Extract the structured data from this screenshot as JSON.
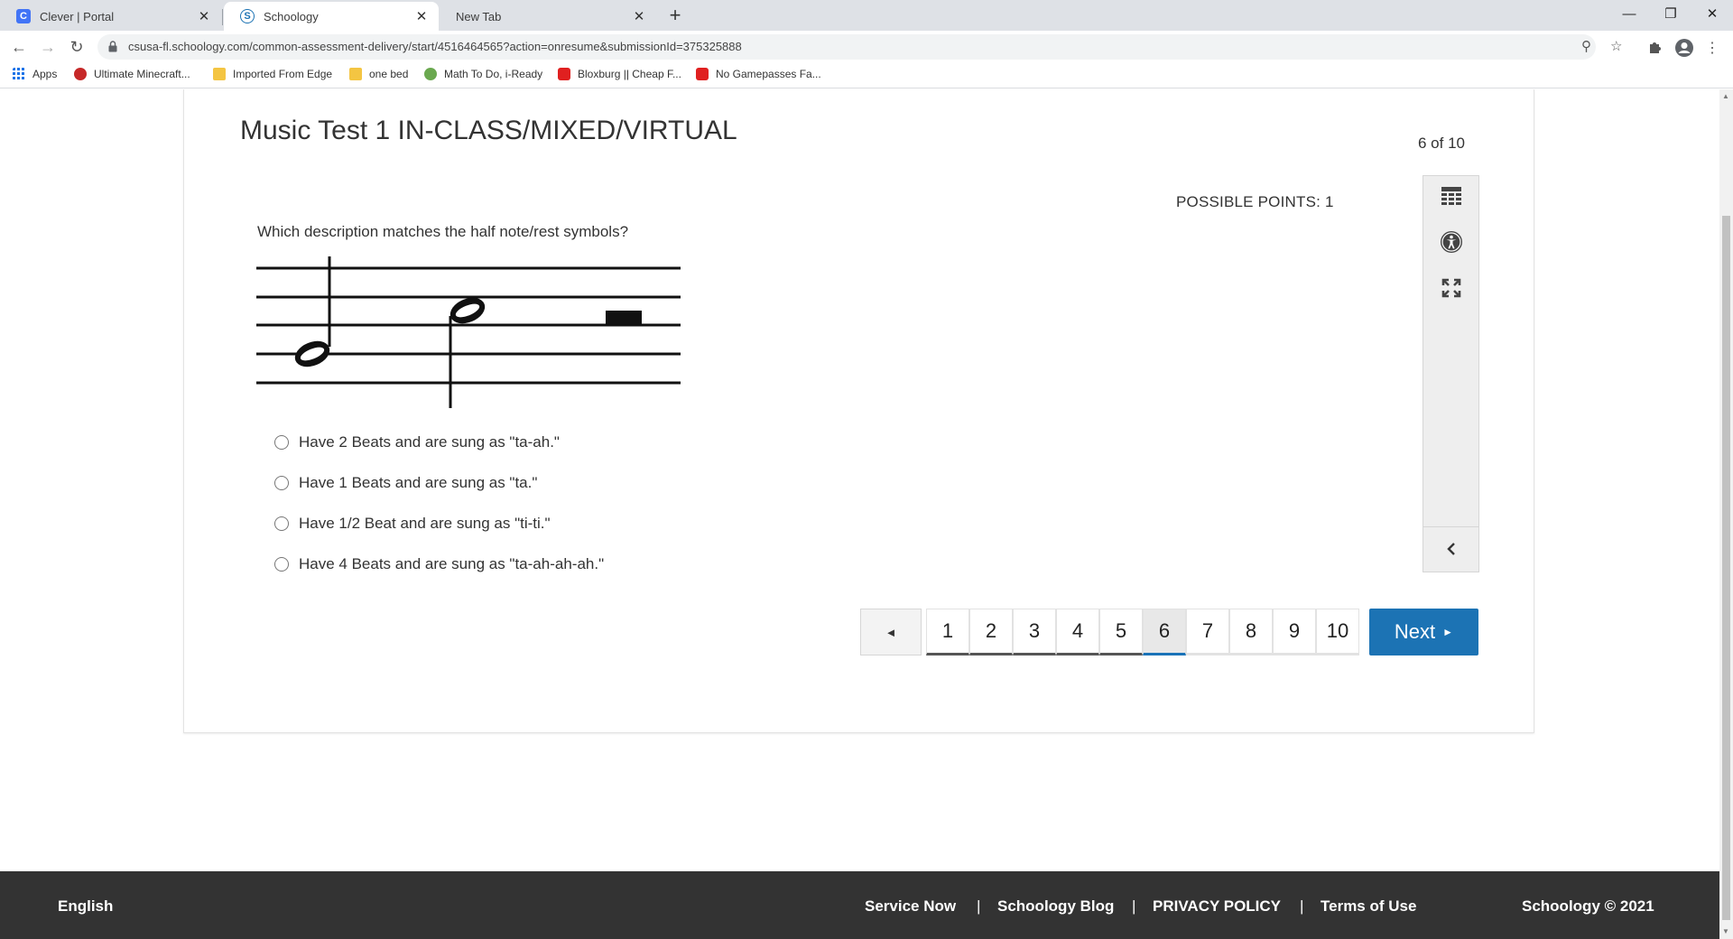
{
  "browser": {
    "tabs": [
      {
        "title": "Clever | Portal",
        "favicon_letter": "C",
        "favicon_color": "#4274f6"
      },
      {
        "title": "Schoology",
        "favicon_letter": "S",
        "favicon_color": "#1c73b4"
      },
      {
        "title": "New Tab",
        "favicon_letter": "",
        "favicon_color": ""
      }
    ],
    "url": "csusa-fl.schoology.com/common-assessment-delivery/start/4516464565?action=onresume&submissionId=375325888",
    "bookmarks": [
      {
        "label": "Apps",
        "icon_color": "#1a73e8"
      },
      {
        "label": "Ultimate Minecraft...",
        "icon_color": "#c62828"
      },
      {
        "label": "Imported From Edge",
        "icon_color": "#f4c542"
      },
      {
        "label": "one bed",
        "icon_color": "#f4c542"
      },
      {
        "label": "Math To Do, i-Ready",
        "icon_color": "#6aa84f"
      },
      {
        "label": "Bloxburg || Cheap F...",
        "icon_color": "#e02020"
      },
      {
        "label": "No Gamepasses Fa...",
        "icon_color": "#e02020"
      }
    ]
  },
  "assessment": {
    "title": "Music Test 1 IN-CLASS/MIXED/VIRTUAL",
    "counter": "6 of 10",
    "possible_points": "POSSIBLE POINTS: 1",
    "question": "Which description matches the half note/rest symbols?",
    "choices": [
      "Have 2 Beats and are sung as \"ta-ah.\"",
      "Have 1 Beats and are sung as \"ta.\"",
      "Have 1/2 Beat and are sung as \"ti-ti.\"",
      "Have 4 Beats and are sung as \"ta-ah-ah-ah.\""
    ],
    "pages": [
      "1",
      "2",
      "3",
      "4",
      "5",
      "6",
      "7",
      "8",
      "9",
      "10"
    ],
    "current_page": "6",
    "prev_label": "◄",
    "next_label": "Next",
    "tools": [
      "calculator-icon",
      "accessibility-icon",
      "fullscreen-icon",
      "collapse-icon"
    ]
  },
  "footer": {
    "language": "English",
    "links": [
      "Service Now",
      "Schoology Blog",
      "PRIVACY POLICY",
      "Terms of Use"
    ],
    "separator": "|",
    "copyright": "Schoology © 2021"
  },
  "colors": {
    "accent": "#1c73b4",
    "footer_bg": "#333333",
    "tab_strip": "#dee1e6"
  }
}
